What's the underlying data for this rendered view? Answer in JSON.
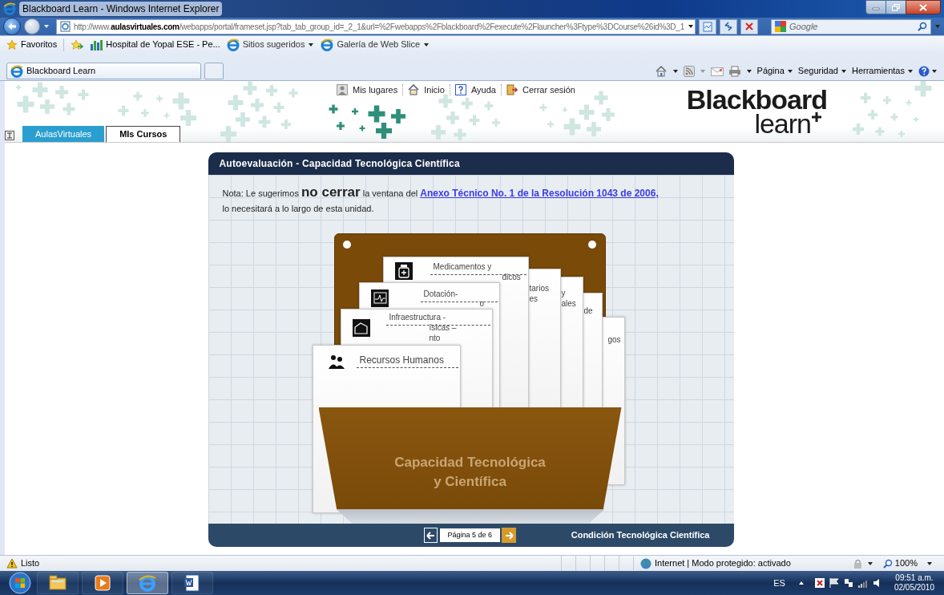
{
  "window": {
    "title": "Blackboard Learn - Windows Internet Explorer"
  },
  "address_bar": {
    "url": "http://www.**aulasvirtuales.com**/webapps/portal/frameset.jsp?tab_tab_group_id=_2_1&url=%2Fwebapps%2Fblackboard%2Fexecute%2Flauncher%3Ftype%3DCourse%26id%3D_1"
  },
  "search": {
    "placeholder": "Google"
  },
  "favorites_bar": {
    "label": "Favoritos",
    "links": [
      {
        "kind": "site",
        "label": "Hospital de Yopal ESE - Pe..."
      },
      {
        "kind": "menu",
        "label": "Sitios sugeridos"
      },
      {
        "kind": "menu",
        "label": "Galería de Web Slice"
      }
    ]
  },
  "tabs": [
    {
      "label": "Blackboard Learn",
      "selected": true
    }
  ],
  "command_bar": [
    "Página",
    "Seguridad",
    "Herramientas"
  ],
  "page": {
    "top_links": [
      "Mis lugares",
      "Inicio",
      "Ayuda",
      "Cerrar sesión"
    ],
    "nav_tabs": [
      {
        "label": "AulasVirtuales",
        "selected": false
      },
      {
        "label": "MIs Cursos",
        "selected": true
      }
    ],
    "logo": {
      "line_1": "Blackboard",
      "line_2": "learn"
    }
  },
  "panel": {
    "title": "Autoevaluación - Capacidad Tecnológica Científica",
    "note": {
      "before": "Nota: Le sugerimos **no cerrar** la ventana del",
      "link": "Anexo Técnico No. 1 de la Resolución 1043 de 2006,",
      "after": "lo necesitará a lo largo de esta unidad."
    },
    "cards": [
      {
        "lines": [
          "gos"
        ]
      },
      {
        "lines": [
          "de"
        ]
      },
      {
        "lines": [
          "y",
          "ales"
        ]
      },
      {
        "lines": [
          "tarios",
          "es"
        ]
      },
      {
        "lines": [
          "Medicamentos y",
          "dicos"
        ]
      },
      {
        "lines": [
          "Dotación-",
          "o"
        ]
      },
      {
        "lines": [
          "Infraestructura -",
          "ísicas –",
          "nto"
        ]
      },
      {
        "lines": [
          "Recursos Humanos"
        ]
      }
    ],
    "folder_label": [
      "Capacidad Tecnológica",
      "y Científica"
    ],
    "pager": "Página 5 de 6",
    "footer_title": "Condición Tecnológica Científica"
  },
  "status_bar": {
    "status": "Listo",
    "zone": "Internet | Modo protegido: activado",
    "zoom": "100%"
  },
  "taskbar": {
    "apps": [
      {
        "kind": "folder",
        "active": false
      },
      {
        "kind": "media",
        "active": false
      },
      {
        "kind": "browser",
        "active": true
      },
      {
        "kind": "word",
        "active": false
      }
    ],
    "language": "ES",
    "time": "09:51 a.m.",
    "date": "02/05/2010"
  }
}
